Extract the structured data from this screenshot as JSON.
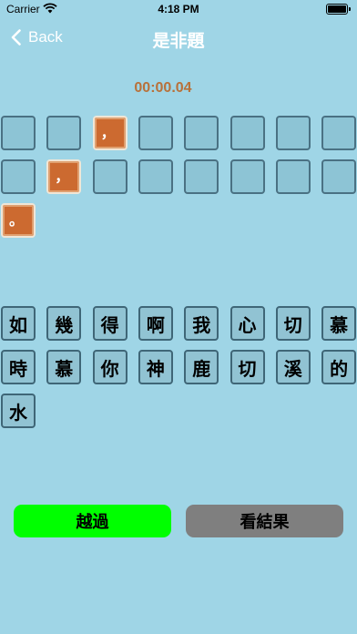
{
  "status_bar": {
    "carrier": "Carrier",
    "time": "4:18 PM"
  },
  "nav": {
    "back_label": "Back",
    "title": "是非題"
  },
  "timer": "00:00.04",
  "answer_slots": [
    "",
    "",
    "，",
    "",
    "",
    "",
    "",
    "",
    "",
    "，",
    "",
    "",
    "",
    "",
    "",
    "",
    "。"
  ],
  "characters": [
    "如",
    "幾",
    "得",
    "啊",
    "我",
    "心",
    "切",
    "慕",
    "時",
    "慕",
    "你",
    "神",
    "鹿",
    "切",
    "溪",
    "的",
    "水"
  ],
  "buttons": {
    "skip_label": "越過",
    "result_label": "看結果"
  },
  "colors": {
    "background": "#9fd5e6",
    "skip": "#00ff00",
    "result": "#7f7f7f",
    "tile_filled": "#cc6a30",
    "timer": "#b8713a"
  }
}
